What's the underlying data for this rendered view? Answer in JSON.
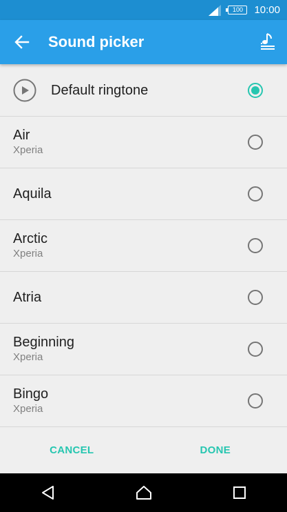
{
  "status_bar": {
    "battery": "100",
    "time": "10:00"
  },
  "app_bar": {
    "title": "Sound picker",
    "back_icon": "arrow-back-icon",
    "action_icon": "music-library-icon"
  },
  "default_item": {
    "label": "Default ringtone",
    "selected": true
  },
  "items": [
    {
      "title": "Air",
      "subtitle": "Xperia",
      "selected": false
    },
    {
      "title": "Aquila",
      "subtitle": "",
      "selected": false
    },
    {
      "title": "Arctic",
      "subtitle": "Xperia",
      "selected": false
    },
    {
      "title": "Atria",
      "subtitle": "",
      "selected": false
    },
    {
      "title": "Beginning",
      "subtitle": "Xperia",
      "selected": false
    },
    {
      "title": "Bingo",
      "subtitle": "Xperia",
      "selected": false
    }
  ],
  "footer": {
    "cancel_label": "CANCEL",
    "done_label": "DONE"
  },
  "colors": {
    "accent": "#26c6b0",
    "app_bar": "#2a9fe8",
    "status_bar": "#1d8ed1"
  }
}
